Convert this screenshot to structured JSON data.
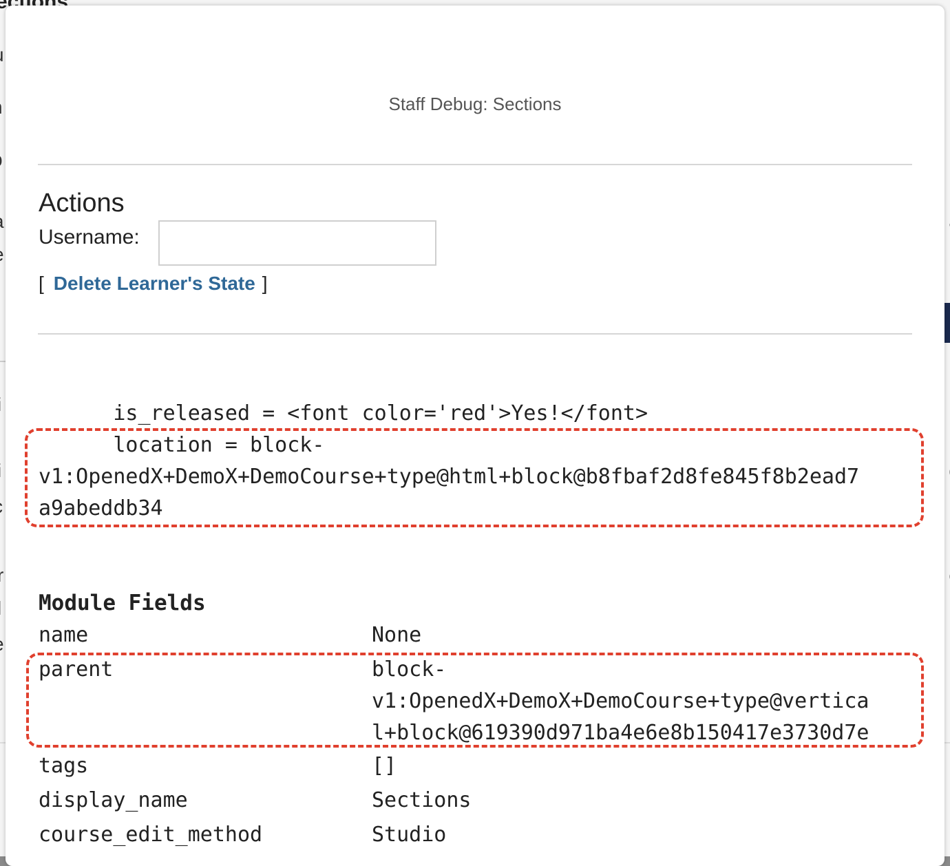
{
  "background": {
    "page_title_fragment": "ections"
  },
  "modal": {
    "title": "Staff Debug: Sections",
    "actions": {
      "heading": "Actions",
      "username_label": "Username:",
      "username_value": "",
      "username_placeholder": "",
      "bracket_open": "[",
      "delete_link": "Delete Learner's State",
      "bracket_close": "]"
    },
    "debug": {
      "line1": "      is_released = <font color='red'>Yes!</font>",
      "line2": "      location = block-",
      "line3": "v1:OpenedX+DemoX+DemoCourse+type@html+block@b8fbaf2d8fe845f8b2ead7",
      "line4": "a9abeddb34"
    },
    "module_fields": {
      "heading": "Module Fields",
      "rows": [
        {
          "key": "name",
          "value": "None"
        },
        {
          "key": "parent",
          "value": "block-\nv1:OpenedX+DemoX+DemoCourse+type@vertica\nl+block@619390d971ba4e6e8b150417e3730d7e"
        },
        {
          "key": "tags",
          "value": "[]"
        },
        {
          "key": "display_name",
          "value": "Sections"
        },
        {
          "key": "course_edit_method",
          "value": "Studio"
        }
      ]
    }
  },
  "colors": {
    "link": "#2f6897",
    "highlight_dash": "#e0402e",
    "divider": "#d6d6d6"
  }
}
